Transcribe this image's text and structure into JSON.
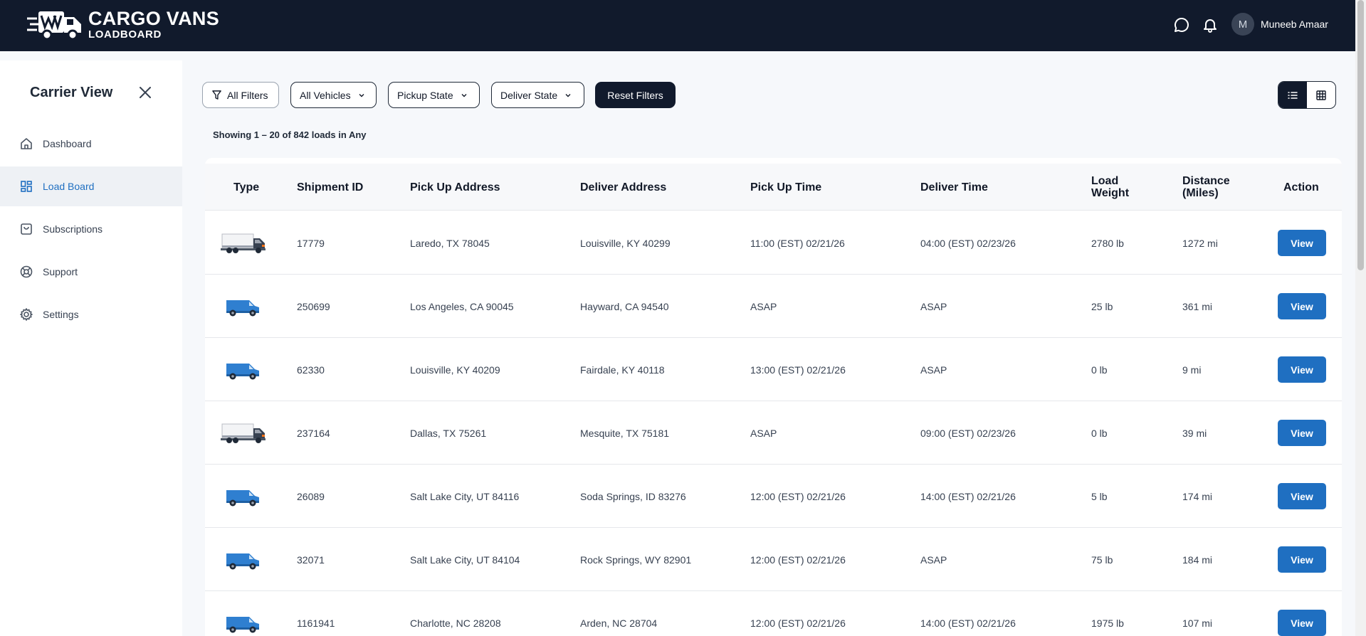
{
  "header": {
    "brand_title": "CARGO VANS",
    "brand_sub": "LOADBOARD",
    "avatar_initial": "M",
    "user_name": "Muneeb Amaar"
  },
  "sidebar": {
    "title": "Carrier View",
    "items": [
      {
        "label": "Dashboard",
        "icon": "home-icon",
        "active": false
      },
      {
        "label": "Load Board",
        "icon": "grid-icon",
        "active": true
      },
      {
        "label": "Subscriptions",
        "icon": "bag-icon",
        "active": false
      },
      {
        "label": "Support",
        "icon": "lifebuoy-icon",
        "active": false
      },
      {
        "label": "Settings",
        "icon": "gear-icon",
        "active": false
      }
    ]
  },
  "filters": {
    "all_filters": "All Filters",
    "vehicles": "All Vehicles",
    "pickup_state": "Pickup State",
    "deliver_state": "Deliver State",
    "reset": "Reset Filters"
  },
  "showing": "Showing 1 – 20 of 842 loads in Any",
  "table": {
    "headers": {
      "type": "Type",
      "shipment": "Shipment ID",
      "pickup": "Pick Up Address",
      "deliver": "Deliver Address",
      "pickup_time": "Pick Up Time",
      "deliver_time": "Deliver Time",
      "weight_1": "Load",
      "weight_2": "Weight",
      "distance_1": "Distance",
      "distance_2": "(Miles)",
      "action": "Action"
    },
    "action_label": "View",
    "rows": [
      {
        "vehicle": "box-truck",
        "id": "17779",
        "pickup": "Laredo, TX 78045",
        "deliver": "Louisville, KY 40299",
        "pickup_time": "11:00 (EST) 02/21/26",
        "deliver_time": "04:00 (EST) 02/23/26",
        "weight": "2780 lb",
        "distance": "1272 mi"
      },
      {
        "vehicle": "cargo-van",
        "id": "250699",
        "pickup": "Los Angeles, CA 90045",
        "deliver": "Hayward, CA 94540",
        "pickup_time": "ASAP",
        "deliver_time": "ASAP",
        "weight": "25 lb",
        "distance": "361 mi"
      },
      {
        "vehicle": "cargo-van",
        "id": "62330",
        "pickup": "Louisville, KY 40209",
        "deliver": "Fairdale, KY 40118",
        "pickup_time": "13:00 (EST) 02/21/26",
        "deliver_time": "ASAP",
        "weight": "0 lb",
        "distance": "9 mi"
      },
      {
        "vehicle": "box-truck",
        "id": "237164",
        "pickup": "Dallas, TX 75261",
        "deliver": "Mesquite, TX 75181",
        "pickup_time": "ASAP",
        "deliver_time": "09:00 (EST) 02/23/26",
        "weight": "0 lb",
        "distance": "39 mi"
      },
      {
        "vehicle": "cargo-van",
        "id": "26089",
        "pickup": "Salt Lake City, UT 84116",
        "deliver": "Soda Springs, ID 83276",
        "pickup_time": "12:00 (EST) 02/21/26",
        "deliver_time": "14:00 (EST) 02/21/26",
        "weight": "5 lb",
        "distance": "174 mi"
      },
      {
        "vehicle": "cargo-van",
        "id": "32071",
        "pickup": "Salt Lake City, UT 84104",
        "deliver": "Rock Springs, WY 82901",
        "pickup_time": "12:00 (EST) 02/21/26",
        "deliver_time": "ASAP",
        "weight": "75 lb",
        "distance": "184 mi"
      },
      {
        "vehicle": "cargo-van",
        "id": "1161941",
        "pickup": "Charlotte, NC 28208",
        "deliver": "Arden, NC 28704",
        "pickup_time": "12:00 (EST) 02/21/26",
        "deliver_time": "14:00 (EST) 02/21/26",
        "weight": "1975 lb",
        "distance": "107 mi"
      }
    ]
  },
  "colors": {
    "navbar": "#111a2c",
    "accent": "#1f6fc1",
    "van_blue": "#2f7fd0"
  }
}
